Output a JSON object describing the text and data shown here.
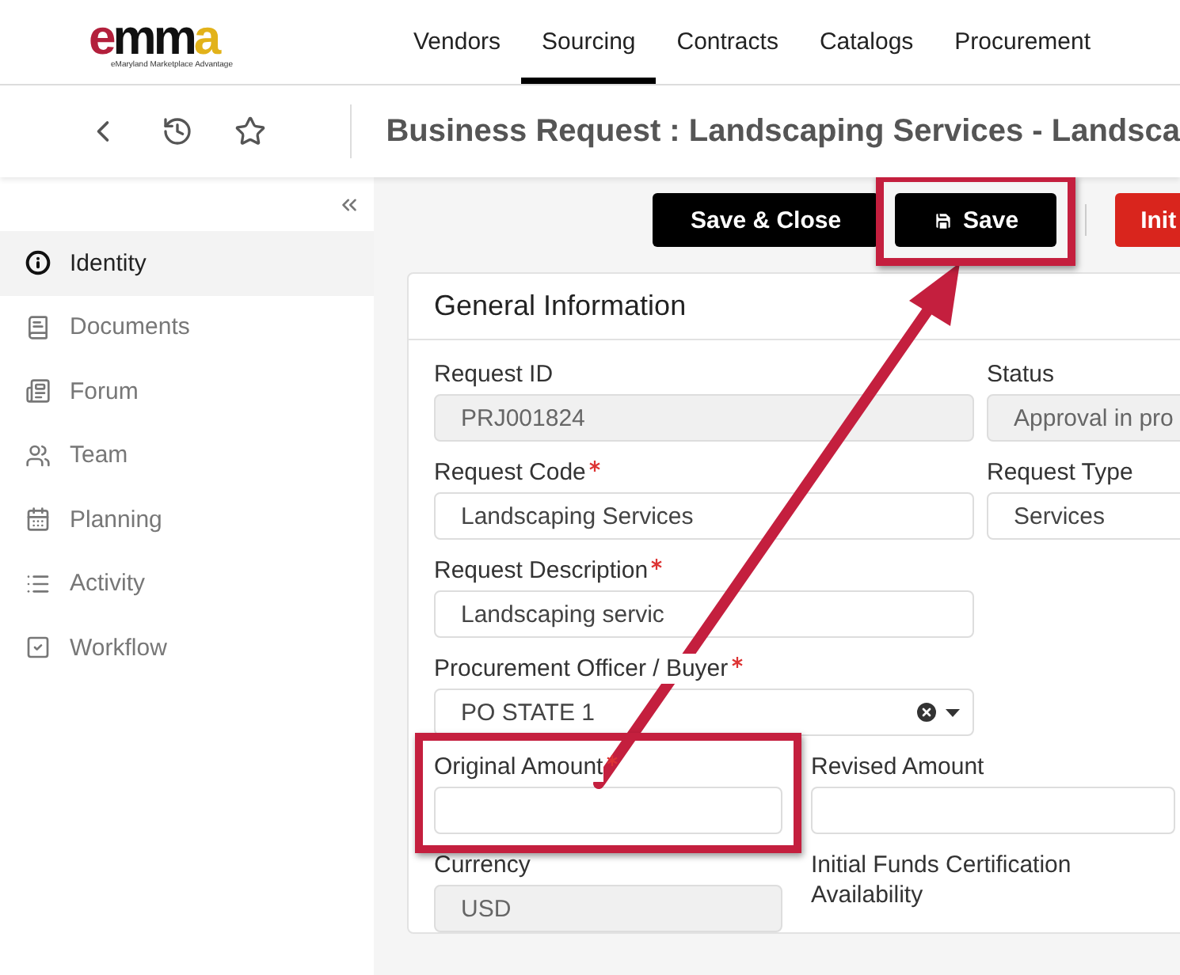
{
  "logo": {
    "text": "emma",
    "tagline": "eMaryland Marketplace Advantage"
  },
  "nav": [
    {
      "label": "Vendors",
      "selected": false
    },
    {
      "label": "Sourcing",
      "selected": true
    },
    {
      "label": "Contracts",
      "selected": false
    },
    {
      "label": "Catalogs",
      "selected": false
    },
    {
      "label": "Procurement",
      "selected": false
    }
  ],
  "page_title": "Business Request : Landscaping Services - Landsca",
  "sidebar": {
    "items": [
      {
        "label": "Identity",
        "selected": true
      },
      {
        "label": "Documents",
        "selected": false
      },
      {
        "label": "Forum",
        "selected": false
      },
      {
        "label": "Team",
        "selected": false
      },
      {
        "label": "Planning",
        "selected": false
      },
      {
        "label": "Activity",
        "selected": false
      },
      {
        "label": "Workflow",
        "selected": false
      }
    ]
  },
  "actions": [
    {
      "label": "Save & Close",
      "kind": "dark",
      "highlighted": false
    },
    {
      "label": "Save",
      "kind": "dark-save",
      "highlighted": true
    },
    {
      "label": "Init",
      "kind": "danger",
      "highlighted": false
    }
  ],
  "card": {
    "title": "General Information",
    "rows": [
      [
        {
          "label": "Request ID",
          "required": false,
          "value": "PRJ001824",
          "disabled": true,
          "kind": "text",
          "highlighted": false
        },
        {
          "label": "Status",
          "required": false,
          "value": "Approval in pro",
          "disabled": true,
          "kind": "text",
          "highlighted": false
        }
      ],
      [
        {
          "label": "Request Code",
          "required": true,
          "value": "Landscaping Services",
          "disabled": false,
          "kind": "text",
          "highlighted": false
        },
        {
          "label": "Request Type",
          "required": false,
          "value": "Services",
          "disabled": false,
          "kind": "text",
          "highlighted": false
        }
      ],
      [
        {
          "label": "Request Description",
          "required": true,
          "value": "Landscaping servic",
          "disabled": false,
          "kind": "text",
          "highlighted": false
        }
      ],
      [
        {
          "label": "Procurement Officer / Buyer",
          "required": true,
          "value": "PO STATE 1",
          "disabled": false,
          "kind": "select",
          "highlighted": false
        }
      ],
      [
        {
          "label": "Original Amount",
          "required": true,
          "disabled": false,
          "kind": "text",
          "highlighted": true
        },
        {
          "label": "Revised Amount",
          "required": false,
          "disabled": false,
          "kind": "text",
          "highlighted": false
        }
      ],
      [
        {
          "label": "Currency",
          "required": false,
          "value": "USD",
          "disabled": true,
          "kind": "text",
          "highlighted": false
        },
        {
          "label": "Initial Funds Certification Availability",
          "required": false,
          "kind": "label",
          "highlighted": false
        }
      ]
    ]
  }
}
